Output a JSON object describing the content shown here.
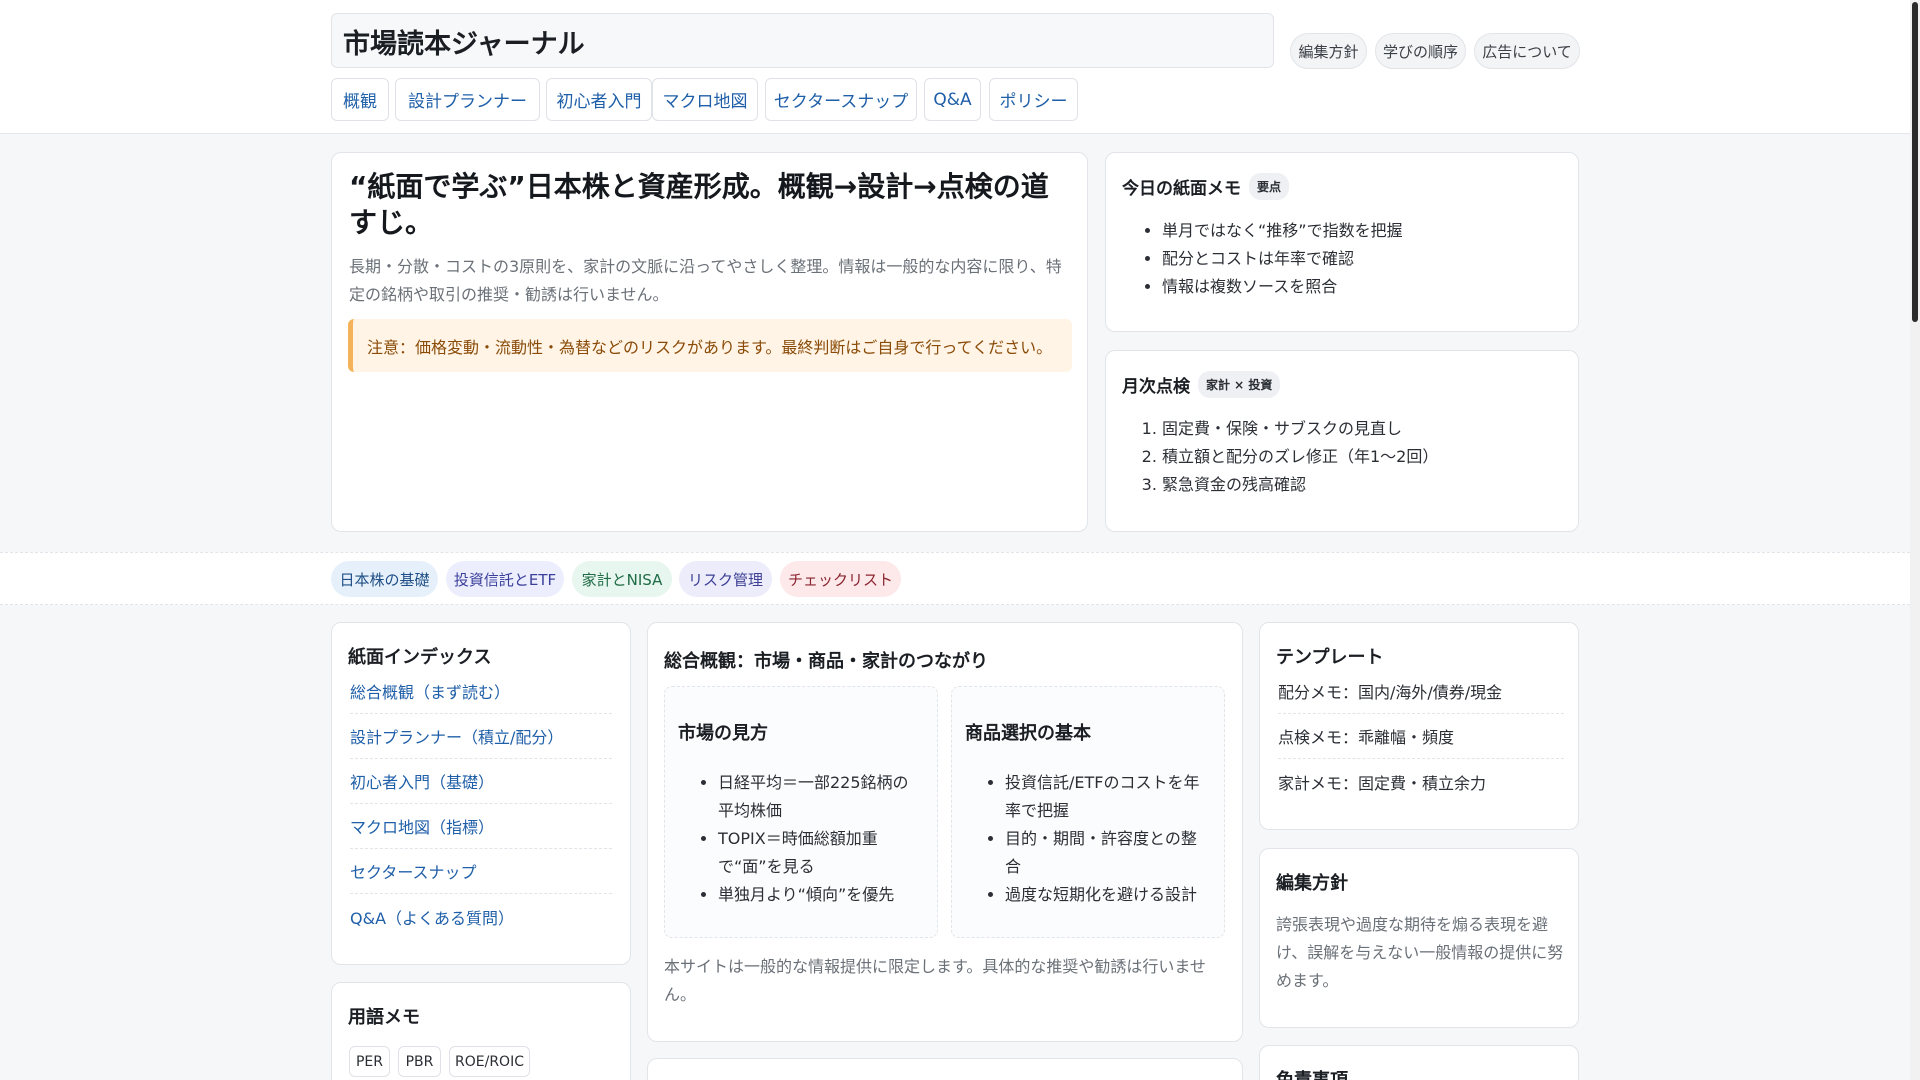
{
  "header": {
    "brand": "市場読本ジャーナル",
    "utility": [
      "編集方針",
      "学びの順序",
      "広告について"
    ],
    "nav": [
      "概観",
      "設計プランナー",
      "初心者入門",
      "マクロ地図",
      "セクタースナップ",
      "Q&A",
      "ポリシー"
    ]
  },
  "hero": {
    "title": "“紙面で学ぶ”日本株と資産形成。概観→設計→点検の道すじ。",
    "lead": "長期・分散・コストの3原則を、家計の文脈に沿ってやさしく整理。情報は一般的な内容に限り、特定の銘柄や取引の推奨・勧誘は行いません。",
    "warning": "注意：価格変動・流動性・為替などのリスクがあります。最終判断はご自身で行ってください。"
  },
  "memo": {
    "title": "今日の紙面メモ",
    "tag": "要点",
    "items": [
      "単月ではなく“推移”で指数を把握",
      "配分とコストは年率で確認",
      "情報は複数ソースを照合"
    ]
  },
  "monthly": {
    "title": "月次点検",
    "tag": "家計 × 投資",
    "items": [
      "固定費・保険・サブスクの見直し",
      "積立額と配分のズレ修正（年1〜2回）",
      "緊急資金の残高確認"
    ]
  },
  "categories": [
    {
      "label": "日本株の基礎",
      "bg": "#e6f0fb",
      "fg": "#1f4f86"
    },
    {
      "label": "投資信託とETF",
      "bg": "#eceefd",
      "fg": "#3a3f9a"
    },
    {
      "label": "家計とNISA",
      "bg": "#e7f6ee",
      "fg": "#1f6b45"
    },
    {
      "label": "リスク管理",
      "bg": "#ececfb",
      "fg": "#3d4095"
    },
    {
      "label": "チェックリスト",
      "bg": "#fde8ea",
      "fg": "#8a2530"
    }
  ],
  "index": {
    "title": "紙面インデックス",
    "links": [
      "総合概観（まず読む）",
      "設計プランナー（積立/配分）",
      "初心者入門（基礎）",
      "マクロ地図（指標）",
      "セクタースナップ",
      "Q&A（よくある質問）"
    ]
  },
  "terms": {
    "title": "用語メモ",
    "items": [
      "PER",
      "PBR",
      "ROE/ROIC"
    ]
  },
  "overview": {
    "title": "総合概観：市場・商品・家計のつながり",
    "market": {
      "title": "市場の見方",
      "items": [
        "日経平均＝一部225銘柄の平均株価",
        "TOPIX＝時価総額加重で“面”を見る",
        "単独月より“傾向”を優先"
      ]
    },
    "product": {
      "title": "商品選択の基本",
      "items": [
        "投資信託/ETFのコストを年率で把握",
        "目的・期間・許容度との整合",
        "過度な短期化を避ける設計"
      ]
    },
    "note": "本サイトは一般的な情報提供に限定します。具体的な推奨や勧誘は行いません。"
  },
  "templates": {
    "title": "テンプレート",
    "items": [
      "配分メモ：国内/海外/債券/現金",
      "点検メモ：乖離幅・頻度",
      "家計メモ：固定費・積立余力"
    ]
  },
  "policy": {
    "title": "編集方針",
    "body": "誇張表現や過度な期待を煽る表現を避け、誤解を与えない一般情報の提供に努めます。"
  },
  "disclaimer": {
    "title": "免責事項"
  }
}
